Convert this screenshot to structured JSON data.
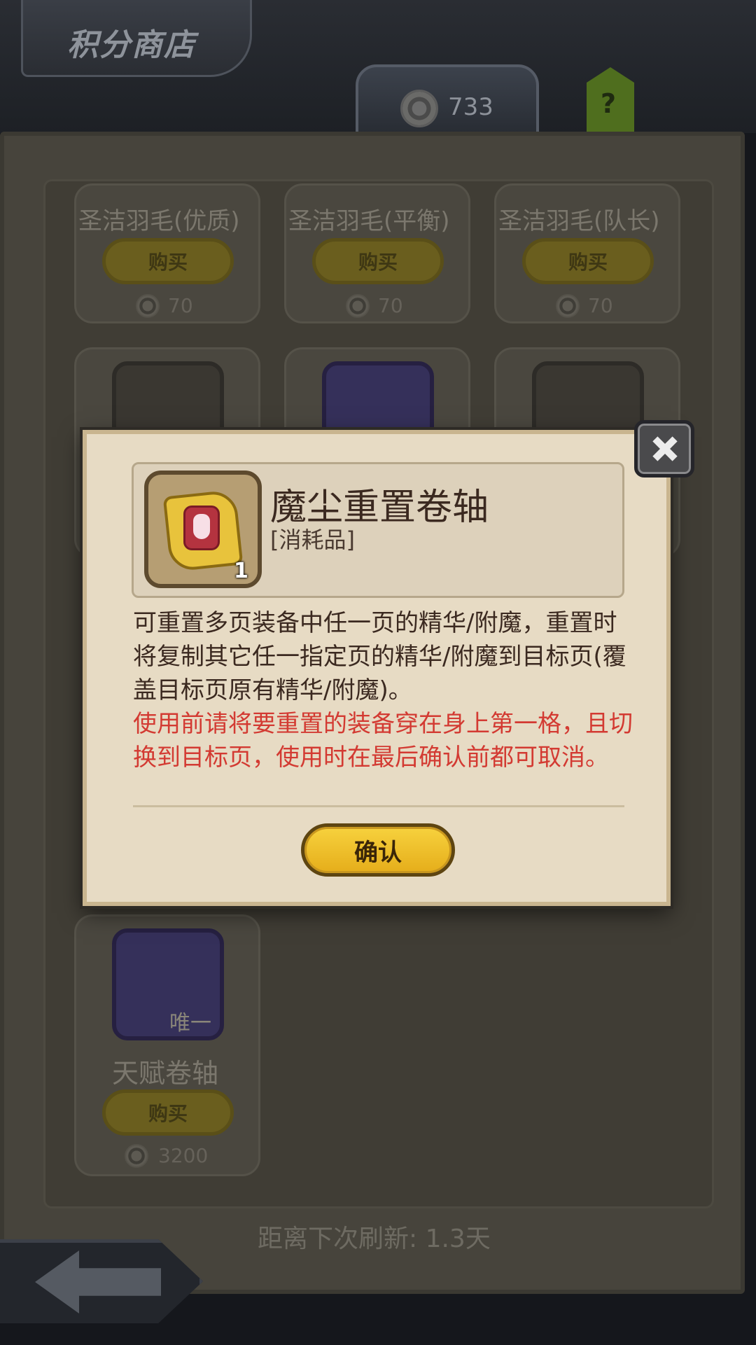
{
  "header": {
    "title": "积分商店",
    "points": "733",
    "help_label": "?"
  },
  "shop_items": [
    {
      "name": "圣洁羽毛(优质)",
      "buy_label": "购买",
      "price": "70"
    },
    {
      "name": "圣洁羽毛(平衡)",
      "buy_label": "购买",
      "price": "70"
    },
    {
      "name": "圣洁羽毛(队长)",
      "buy_label": "购买",
      "price": "70"
    },
    {
      "name": "天赋卷轴",
      "buy_label": "购买",
      "price": "3200",
      "tag": "唯一"
    }
  ],
  "refresh": "距离下次刷新: 1.3天",
  "popup": {
    "title": "魔尘重置卷轴",
    "type": "[消耗品]",
    "count": "1",
    "desc_black": "可重置多页装备中任一页的精华/附魔，重置时将复制其它任一指定页的精华/附魔到目标页(覆盖目标页原有精华/附魔)。",
    "desc_red": "使用前请将要重置的装备穿在身上第一格，且切换到目标页，使用时在最后确认前都可取消。",
    "confirm_label": "确认"
  },
  "icons": {
    "points": "points-coin-icon",
    "help": "help-icon",
    "close": "close-icon",
    "back": "back-arrow-icon",
    "scroll": "scroll-icon"
  },
  "colors": {
    "warning_text": "#d33a32",
    "confirm_button": "#f2c12e",
    "popup_bg": "#e7dbc4"
  }
}
